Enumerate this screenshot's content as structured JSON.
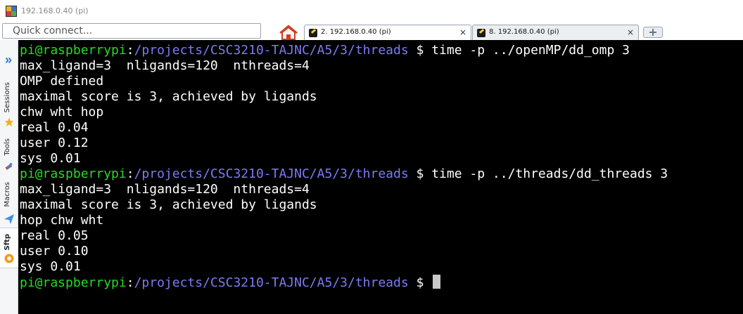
{
  "window": {
    "title": "192.168.0.40 (pi)"
  },
  "quick_connect": {
    "placeholder": "Quick connect..."
  },
  "tabs": [
    {
      "label": "2. 192.168.0.40 (pi)",
      "close": "×",
      "active": true
    },
    {
      "label": "8. 192.168.0.40 (pi)",
      "close": "×",
      "active": false
    }
  ],
  "sidebar": {
    "items": [
      {
        "label": "Sessions",
        "icon": "star-icon"
      },
      {
        "label": "Tools",
        "icon": "tools-icon"
      },
      {
        "label": "Macros",
        "icon": "paper-plane-icon"
      },
      {
        "label": "Sftp",
        "icon": "sftp-icon"
      }
    ]
  },
  "terminal": {
    "prompt_user": "pi@raspberrypi",
    "prompt_sep": ":",
    "prompt_path": "/projects/CSC3210-TAJNC/A5/3/threads",
    "prompt_tail": " $ ",
    "commands": [
      "time -p ../openMP/dd_omp 3",
      "time -p ../threads/dd_threads 3"
    ],
    "output1": [
      "max_ligand=3  nligands=120  nthreads=4",
      "OMP defined",
      "maximal score is 3, achieved by ligands",
      "chw wht hop",
      "real 0.04",
      "user 0.12",
      "sys 0.01"
    ],
    "output2": [
      "max_ligand=3  nligands=120  nthreads=4",
      "maximal score is 3, achieved by ligands",
      "hop chw wht",
      "real 0.05",
      "user 0.10",
      "sys 0.01"
    ]
  }
}
